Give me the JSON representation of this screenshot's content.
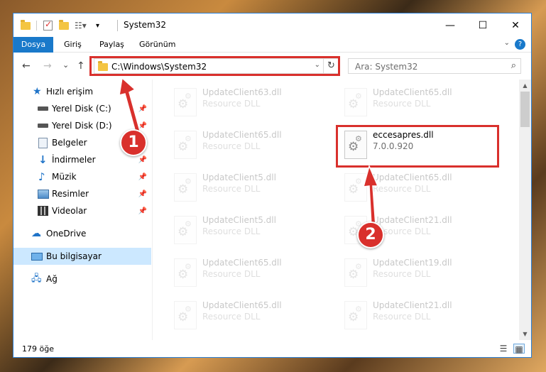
{
  "window": {
    "title": "System32",
    "accent_color": "#1979ca",
    "controls": {
      "minimize": "—",
      "maximize": "☐",
      "close": "✕"
    }
  },
  "ribbon": {
    "tabs": [
      {
        "label": "Dosya"
      },
      {
        "label": "Giriş"
      },
      {
        "label": "Paylaş"
      },
      {
        "label": "Görünüm"
      }
    ],
    "help_icon": "?"
  },
  "navigation": {
    "back_icon": "←",
    "forward_icon": "→",
    "recent_icon": "⌄",
    "up_icon": "↑",
    "address_path": "C:\\Windows\\System32",
    "refresh_icon": "↻",
    "search_placeholder": "Ara: System32",
    "search_icon": "⌕"
  },
  "sidebar": {
    "items": [
      {
        "label": "Hızlı erişim",
        "icon": "star-icon",
        "pinned": false
      },
      {
        "label": "Yerel Disk (C:)",
        "icon": "disk-icon",
        "pinned": true
      },
      {
        "label": "Yerel Disk (D:)",
        "icon": "disk-icon",
        "pinned": true
      },
      {
        "label": "Belgeler",
        "icon": "documents-icon",
        "pinned": true
      },
      {
        "label": "İndirmeler",
        "icon": "download-icon",
        "pinned": true
      },
      {
        "label": "Müzik",
        "icon": "music-icon",
        "pinned": true
      },
      {
        "label": "Resimler",
        "icon": "pictures-icon",
        "pinned": true
      },
      {
        "label": "Videolar",
        "icon": "videos-icon",
        "pinned": true
      },
      {
        "label": "OneDrive",
        "icon": "cloud-icon",
        "pinned": false
      },
      {
        "label": "Bu bilgisayar",
        "icon": "computer-icon",
        "pinned": false,
        "selected": true
      },
      {
        "label": "Ağ",
        "icon": "network-icon",
        "pinned": false
      }
    ]
  },
  "files": {
    "left_column": [
      {
        "name": "UpdateClient63.dll",
        "sub": "Resource DLL"
      },
      {
        "name": "UpdateClient65.dll",
        "sub": "Resource DLL"
      },
      {
        "name": "UpdateClient5.dll",
        "sub": "Resource DLL"
      },
      {
        "name": "UpdateClient5.dll",
        "sub": "Resource DLL"
      },
      {
        "name": "UpdateClient65.dll",
        "sub": "Resource DLL"
      },
      {
        "name": "UpdateClient65.dll",
        "sub": "Resource DLL"
      }
    ],
    "right_column": [
      {
        "name": "UpdateClient65.dll",
        "sub": "Resource DLL"
      },
      {
        "name": "eccesapres.dll",
        "sub": "7.0.0.920",
        "highlighted": true
      },
      {
        "name": "UpdateClient65.dll",
        "sub": "Resource DLL"
      },
      {
        "name": "UpdateClient21.dll",
        "sub": "Resource DLL"
      },
      {
        "name": "UpdateClient19.dll",
        "sub": "Resource DLL"
      },
      {
        "name": "UpdateClient21.dll",
        "sub": "Resource DLL"
      }
    ]
  },
  "status": {
    "item_count": "179 öğe"
  },
  "annotations": {
    "step1_label": "1",
    "step2_label": "2",
    "highlight_color": "#d9302c"
  }
}
